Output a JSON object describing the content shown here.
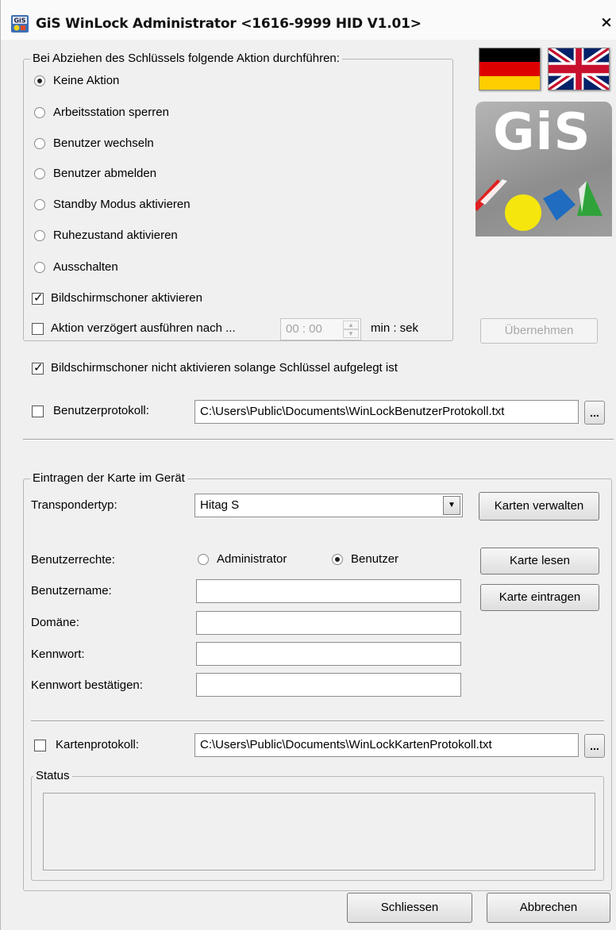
{
  "window": {
    "title": "GiS WinLock Administrator <1616-9999 HID V1.01>",
    "close_glyph": "×",
    "app_icon_text": "GiS"
  },
  "action_group": {
    "legend": "Bei Abziehen des Schlüssels folgende Aktion durchführen:",
    "options": [
      {
        "label": "Keine Aktion",
        "selected": true
      },
      {
        "label": "Arbeitsstation sperren",
        "selected": false
      },
      {
        "label": "Benutzer wechseln",
        "selected": false
      },
      {
        "label": "Benutzer abmelden",
        "selected": false
      },
      {
        "label": "Standby Modus aktivieren",
        "selected": false
      },
      {
        "label": "Ruhezustand aktivieren",
        "selected": false
      },
      {
        "label": "Ausschalten",
        "selected": false
      }
    ],
    "screensaver_label": "Bildschirmschoner aktivieren",
    "screensaver_checked": true,
    "delay_label": "Aktion verzögert ausführen nach ...",
    "delay_checked": false,
    "delay_value": "00 : 00",
    "delay_unit": "min : sek"
  },
  "logo": {
    "text": "GiS"
  },
  "languages": {
    "german": "german-flag-icon",
    "english": "uk-flag-icon"
  },
  "apply_button": "Übernehmen",
  "no_screensaver": {
    "label": "Bildschirmschoner nicht aktivieren solange Schlüssel aufgelegt ist",
    "checked": true
  },
  "user_log": {
    "label": "Benutzerprotokoll:",
    "checked": false,
    "path": "C:\\Users\\Public\\Documents\\WinLockBenutzerProtokoll.txt",
    "browse": "..."
  },
  "card_group": {
    "legend": "Eintragen der Karte im Gerät",
    "transponder_label": "Transpondertyp:",
    "transponder_value": "Hitag S",
    "manage_cards": "Karten verwalten",
    "rights_label": "Benutzerrechte:",
    "rights_admin": "Administrator",
    "rights_user": "Benutzer",
    "rights_selected": "Benutzer",
    "read_card": "Karte lesen",
    "write_card": "Karte eintragen",
    "username_label": "Benutzername:",
    "domain_label": "Domäne:",
    "password_label": "Kennwort:",
    "password_confirm_label": "Kennwort bestätigen:",
    "username_value": "",
    "domain_value": "",
    "password_value": "",
    "password_confirm_value": "",
    "card_log_label": "Kartenprotokoll:",
    "card_log_checked": false,
    "card_log_path": "C:\\Users\\Public\\Documents\\WinLockKartenProtokoll.txt",
    "card_log_browse": "...",
    "status_legend": "Status",
    "status_text": ""
  },
  "footer": {
    "close": "Schliessen",
    "cancel": "Abbrechen"
  },
  "colors": {
    "window_bg": "#f0f0f0",
    "logo_bg": "#9a9a9a",
    "logo_text": "#ffffff"
  }
}
